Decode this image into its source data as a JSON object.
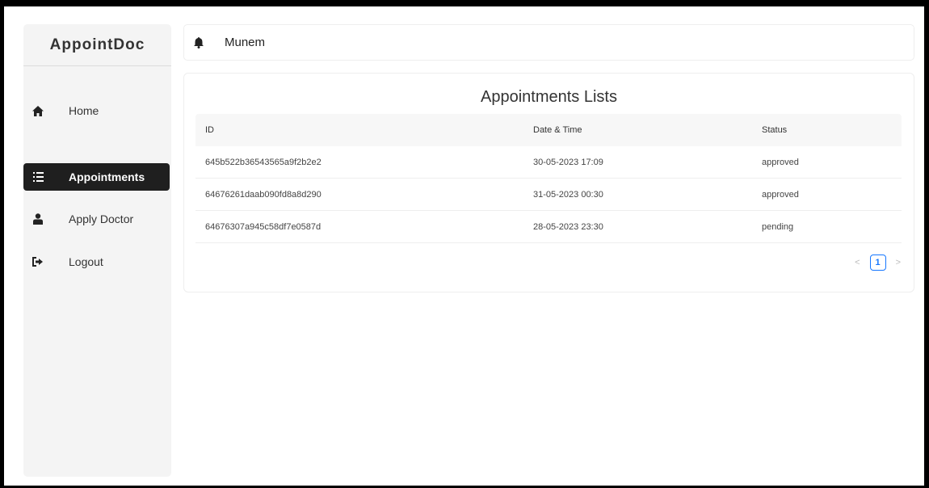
{
  "sidebar": {
    "logo": "AppointDoc",
    "items": [
      {
        "label": "Home",
        "icon": "home-icon",
        "active": false
      },
      {
        "label": "Appointments",
        "icon": "list-icon",
        "active": true
      },
      {
        "label": "Apply Doctor",
        "icon": "doctor-icon",
        "active": false
      },
      {
        "label": "Logout",
        "icon": "logout-icon",
        "active": false
      }
    ]
  },
  "header": {
    "icon": "bell-icon",
    "user_name": "Munem"
  },
  "main": {
    "title": "Appointments Lists",
    "columns": [
      "ID",
      "Date & Time",
      "Status"
    ],
    "rows": [
      {
        "id": "645b522b36543565a9f2b2e2",
        "datetime": "30-05-2023 17:09",
        "status": "approved"
      },
      {
        "id": "64676261daab090fd8a8d290",
        "datetime": "31-05-2023 00:30",
        "status": "approved"
      },
      {
        "id": "64676307a945c58df7e0587d",
        "datetime": "28-05-2023 23:30",
        "status": "pending"
      }
    ],
    "pagination": {
      "prev": "<",
      "current": "1",
      "next": ">"
    }
  },
  "colors": {
    "active_bg": "#1f1f1f",
    "accent": "#1677ff",
    "sidebar_bg": "#f4f4f4"
  }
}
